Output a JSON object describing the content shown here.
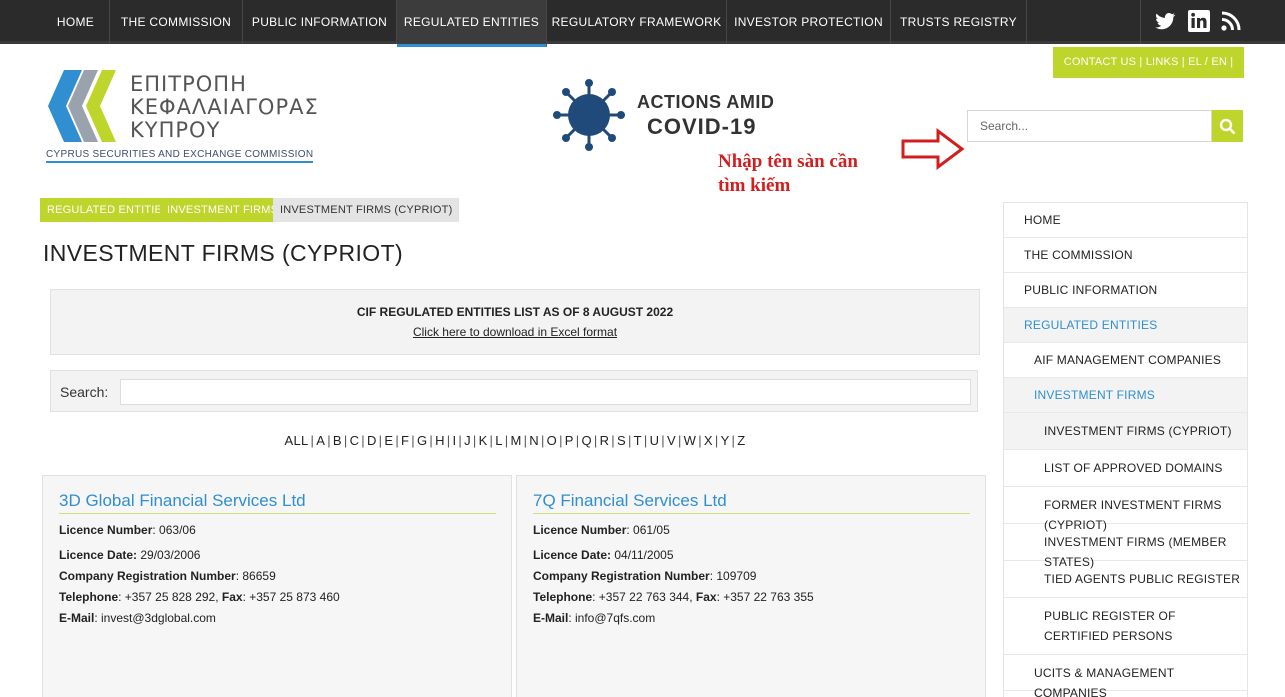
{
  "topnav": {
    "items": [
      "HOME",
      "THE COMMISSION",
      "PUBLIC INFORMATION",
      "REGULATED ENTITIES",
      "REGULATORY FRAMEWORK",
      "INVESTOR PROTECTION",
      "TRUSTS REGISTRY"
    ],
    "active_index": 3
  },
  "header": {
    "contact_bar": "CONTACT US  |  LINKS  |   EL / EN |",
    "logo_lines": [
      "ΕΠΙΤΡΟΠΗ",
      "ΚΕΦΑΛΑΙΑΓΟΡΑΣ",
      "ΚΥΠΡΟΥ"
    ],
    "logo_subtitle": "CYPRUS SECURITIES AND EXCHANGE COMMISSION",
    "covid_line1": "ACTIONS AMID",
    "covid_line2": "COVID-19",
    "search_placeholder": "Search..."
  },
  "annotation": {
    "line1": "Nhập tên sàn cần",
    "line2": "tìm kiếm",
    "color": "#d21e1e"
  },
  "breadcrumb": [
    "REGULATED ENTITIES",
    "INVESTMENT FIRMS",
    "INVESTMENT FIRMS (CYPRIOT)"
  ],
  "page_title": "INVESTMENT FIRMS (CYPRIOT)",
  "notice": {
    "heading": "CIF REGULATED ENTITIES LIST AS OF 8 AUGUST 2022",
    "link": "Click here to download in Excel format"
  },
  "filter": {
    "label": "Search:"
  },
  "alphabet": [
    "ALL",
    "A",
    "B",
    "C",
    "D",
    "E",
    "F",
    "G",
    "H",
    "I",
    "J",
    "K",
    "L",
    "M",
    "N",
    "O",
    "P",
    "Q",
    "R",
    "S",
    "T",
    "U",
    "V",
    "W",
    "X",
    "Y",
    "Z"
  ],
  "labels": {
    "licence_number": "Licence Number",
    "licence_date": "Licence Date:",
    "company_reg": "Company Registration Number",
    "telephone": "Telephone",
    "fax": "Fax",
    "email": "E-Mail"
  },
  "firms": [
    {
      "name": "3D Global Financial Services Ltd",
      "licence_number": ": 063/06",
      "licence_date": " 29/03/2006",
      "company_reg": ": 86659",
      "telephone": ": +357 25 828 292, ",
      "fax": ": +357 25 873 460",
      "email": ": invest@3dglobal.com"
    },
    {
      "name": "7Q Financial Services Ltd",
      "licence_number": ": 061/05",
      "licence_date": " 04/11/2005",
      "company_reg": ": 109709",
      "telephone": ": +357 22 763 344, ",
      "fax": ": +357 22 763 355",
      "email": ": info@7qfs.com"
    }
  ],
  "sidebar": {
    "items": [
      {
        "label": "HOME"
      },
      {
        "label": "THE COMMISSION"
      },
      {
        "label": "PUBLIC INFORMATION"
      },
      {
        "label": "REGULATED ENTITIES"
      },
      {
        "label": "AIF MANAGEMENT COMPANIES"
      },
      {
        "label": "INVESTMENT FIRMS"
      },
      {
        "label": "INVESTMENT FIRMS (CYPRIOT)"
      },
      {
        "label": "LIST OF APPROVED DOMAINS"
      },
      {
        "label": "FORMER INVESTMENT FIRMS (CYPRIOT)"
      },
      {
        "label": "INVESTMENT FIRMS (MEMBER STATES)"
      },
      {
        "label": "TIED AGENTS PUBLIC REGISTER"
      },
      {
        "label": "PUBLIC REGISTER OF CERTIFIED PERSONS"
      },
      {
        "label": "UCITS & MANAGEMENT COMPANIES"
      }
    ]
  },
  "colors": {
    "accent_green": "#bed52c",
    "link_blue": "#2f8fd0",
    "nav_dark": "#2b2b2b"
  },
  "icons": [
    "twitter-icon",
    "linkedin-icon",
    "rss-icon",
    "search-icon",
    "covid-virus-icon",
    "red-arrow-icon"
  ]
}
